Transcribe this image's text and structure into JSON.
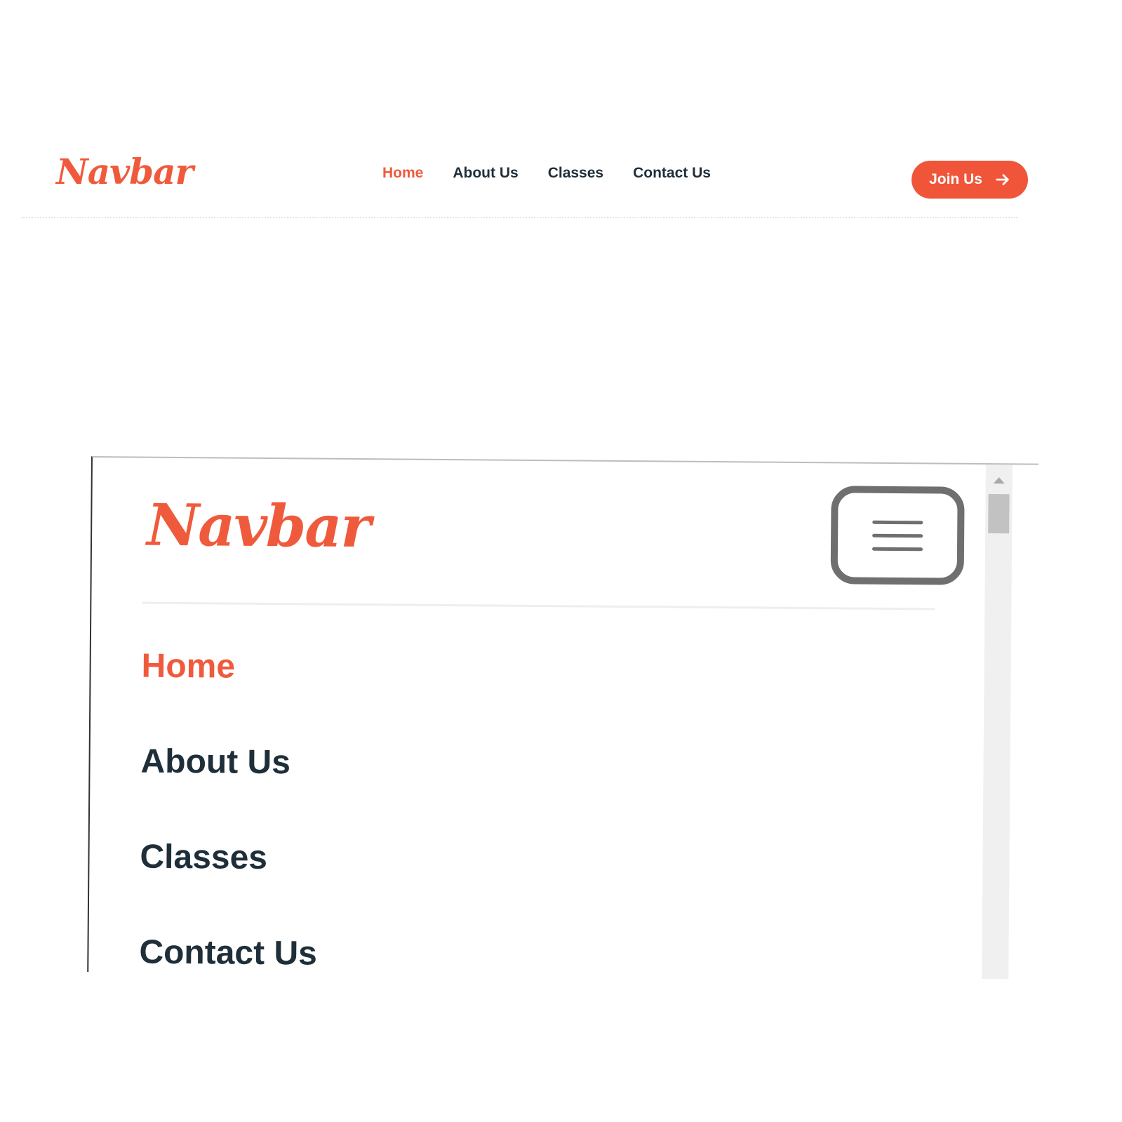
{
  "desktop": {
    "logo": "Navbar",
    "nav": [
      {
        "label": "Home",
        "active": true
      },
      {
        "label": "About Us",
        "active": false
      },
      {
        "label": "Classes",
        "active": false
      },
      {
        "label": "Contact Us",
        "active": false
      }
    ],
    "cta_label": "Join Us",
    "cta_icon": "arrow-right-icon"
  },
  "mobile": {
    "logo": "Navbar",
    "menu_icon": "hamburger-menu-icon",
    "nav": [
      {
        "label": "Home",
        "active": true
      },
      {
        "label": "About Us",
        "active": false
      },
      {
        "label": "Classes",
        "active": false
      },
      {
        "label": "Contact Us",
        "active": false
      }
    ]
  },
  "colors": {
    "brand": "#f05a3c",
    "text": "#1f2f3a",
    "menu_icon": "#6f6f6f"
  }
}
